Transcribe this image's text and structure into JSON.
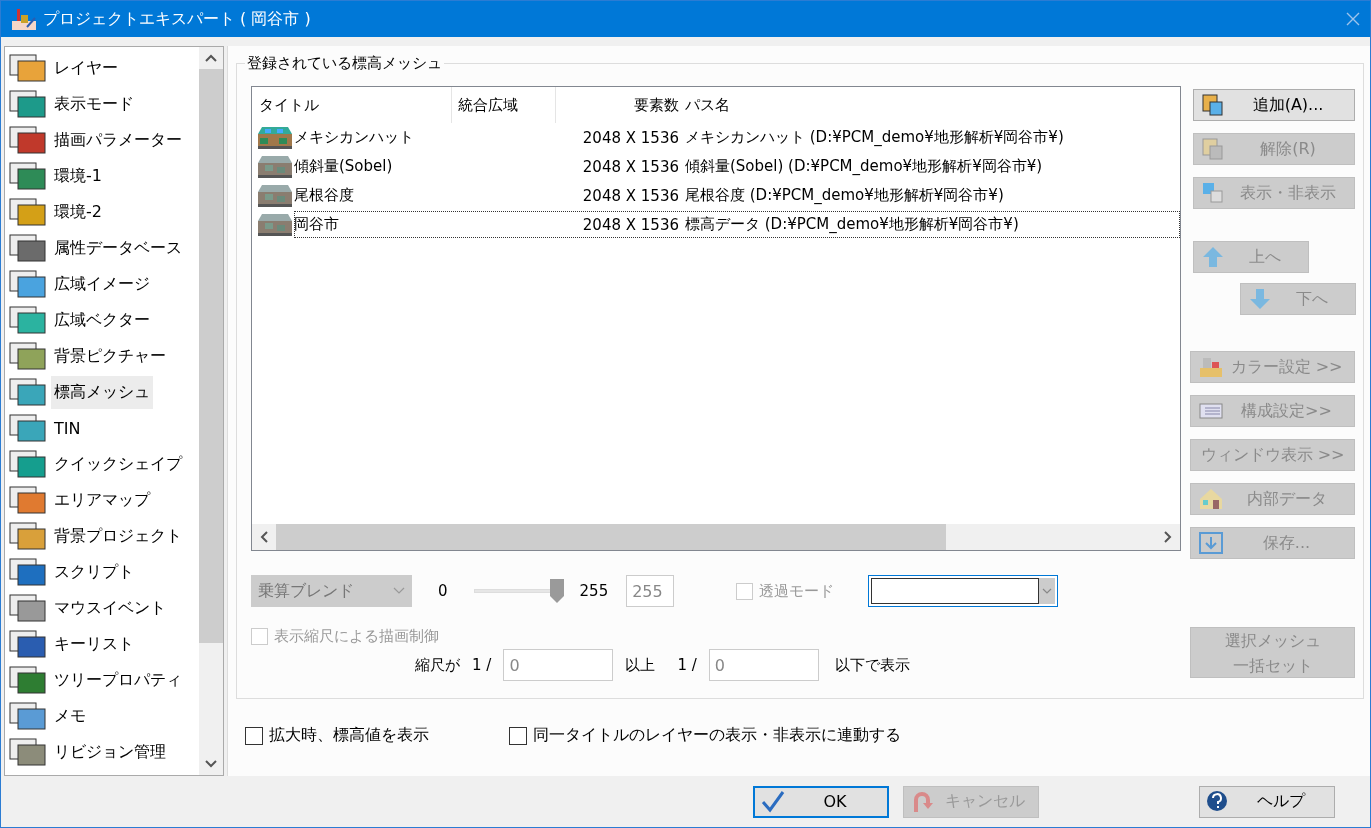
{
  "window": {
    "title": "プロジェクトエキスパート ( 岡谷市 )"
  },
  "sidebar": {
    "items": [
      {
        "label": "レイヤー",
        "selected": false
      },
      {
        "label": "表示モード",
        "selected": false
      },
      {
        "label": "描画パラメーター",
        "selected": false
      },
      {
        "label": "環境-1",
        "selected": false
      },
      {
        "label": "環境-2",
        "selected": false
      },
      {
        "label": "属性データベース",
        "selected": false
      },
      {
        "label": "広域イメージ",
        "selected": false
      },
      {
        "label": "広域ベクター",
        "selected": false
      },
      {
        "label": "背景ピクチャー",
        "selected": false
      },
      {
        "label": "標高メッシュ",
        "selected": true
      },
      {
        "label": "TIN",
        "selected": false
      },
      {
        "label": "クイックシェイプ",
        "selected": false
      },
      {
        "label": "エリアマップ",
        "selected": false
      },
      {
        "label": "背景プロジェクト",
        "selected": false
      },
      {
        "label": "スクリプト",
        "selected": false
      },
      {
        "label": "マウスイベント",
        "selected": false
      },
      {
        "label": "キーリスト",
        "selected": false
      },
      {
        "label": "ツリープロパティ",
        "selected": false
      },
      {
        "label": "メモ",
        "selected": false
      },
      {
        "label": "リビジョン管理",
        "selected": false
      }
    ]
  },
  "group": {
    "label": "登録されている標高メッシュ",
    "table": {
      "columns": [
        "タイトル",
        "統合広域",
        "要素数",
        "パス名"
      ],
      "rows": [
        {
          "kind": "colored",
          "title": "メキシカンハット",
          "elements": "2048 X 1536",
          "path": "メキシカンハット (D:¥PCM_demo¥地形解析¥岡谷市¥)",
          "focused": false
        },
        {
          "kind": "plain",
          "title": "傾斜量(Sobel)",
          "elements": "2048 X 1536",
          "path": "傾斜量(Sobel) (D:¥PCM_demo¥地形解析¥岡谷市¥)",
          "focused": false
        },
        {
          "kind": "plain",
          "title": "尾根谷度",
          "elements": "2048 X 1536",
          "path": "尾根谷度 (D:¥PCM_demo¥地形解析¥岡谷市¥)",
          "focused": false
        },
        {
          "kind": "plain",
          "title": "岡谷市",
          "elements": "2048 X 1536",
          "path": "標高データ (D:¥PCM_demo¥地形解析¥岡谷市¥)",
          "focused": true
        }
      ]
    },
    "blend": {
      "value": "乗算ブレンド",
      "disabled": true
    },
    "opacity": {
      "min": "0",
      "max": "255",
      "level": 1.0,
      "value": "255"
    },
    "transparent_mode": {
      "label": "透過モード",
      "checked": false,
      "disabled": true
    },
    "color_select": {
      "disabled": false
    },
    "scale_control": {
      "label": "表示縮尺による描画制御",
      "checked": false,
      "disabled": true
    },
    "scale_range": {
      "prefix": "縮尺が",
      "ratio_1": "1 /",
      "min": "0",
      "middle": "以上",
      "ratio_2": "1 /",
      "max": "0",
      "suffix": "以下で表示"
    },
    "buttons": [
      {
        "kind": "add",
        "label": "追加(A)...",
        "disabled": false
      },
      {
        "kind": "remove",
        "label": "解除(R)",
        "disabled": true
      },
      {
        "kind": "toggle",
        "label": "表示・非表示",
        "disabled": true
      },
      {
        "kind": "up",
        "label": "上へ",
        "disabled": true
      },
      {
        "kind": "down",
        "label": "下へ",
        "disabled": true
      },
      {
        "kind": "color",
        "label": "カラー設定 >>",
        "disabled": true
      },
      {
        "kind": "layout",
        "label": "構成設定>>",
        "disabled": true
      },
      {
        "kind": "text",
        "label": "ウィンドウ表示 >>",
        "disabled": true
      },
      {
        "kind": "house",
        "label": "内部データ",
        "disabled": true
      },
      {
        "kind": "save",
        "label": "保存...",
        "disabled": true
      },
      {
        "kind": "bulk",
        "lines": [
          "選択メッシュ",
          "一括セット"
        ],
        "disabled": true
      }
    ]
  },
  "options": [
    {
      "label": "拡大時、標高値を表示",
      "checked": false
    },
    {
      "label": "同一タイトルのレイヤーの表示・非表示に連動する",
      "checked": false
    }
  ],
  "footer": {
    "buttons": [
      {
        "kind": "ok",
        "label": "OK",
        "disabled": false
      },
      {
        "kind": "cancel",
        "label": "キャンセル",
        "disabled": true
      },
      {
        "kind": "help",
        "label": "ヘルプ",
        "disabled": false
      }
    ]
  }
}
